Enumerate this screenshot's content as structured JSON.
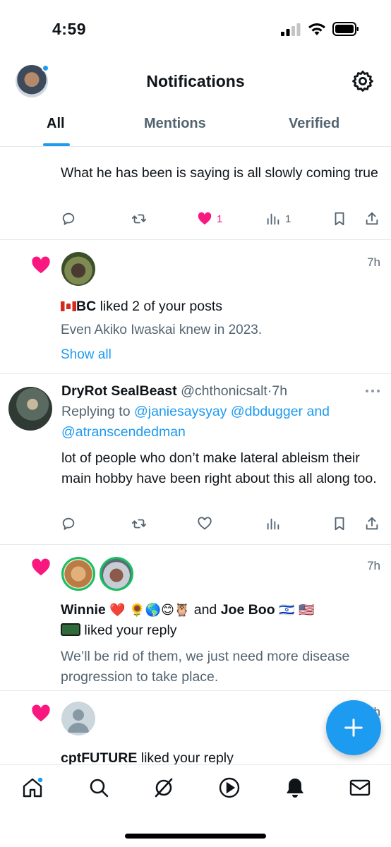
{
  "status": {
    "time": "4:59"
  },
  "header": {
    "title": "Notifications"
  },
  "tabs": [
    {
      "label": "All",
      "active": true
    },
    {
      "label": "Mentions",
      "active": false
    },
    {
      "label": "Verified",
      "active": false
    }
  ],
  "items": {
    "post1": {
      "text": "What he has been is saying is all slowly coming true",
      "likes": "1",
      "views": "1"
    },
    "like1": {
      "time": "7h",
      "actor": "BC",
      "action": " liked 2 of your posts",
      "preview": "Even Akiko Iwaskai knew in 2023.",
      "show_all": "Show all"
    },
    "reply1": {
      "name": "DryRot SealBeast",
      "handle": "@chthonicsalt",
      "dot": "·",
      "time": "7h",
      "replying_prefix": "Replying to ",
      "mention1": "@janiesaysyay",
      "mention2": "@dbdugger",
      "and": " and",
      "mention3": "@atranscendedman",
      "text": "lot of people who don’t make lateral ableism their main hobby have been right about this all along too."
    },
    "like2": {
      "time": "7h",
      "actor1": "Winnie",
      "emojis1": "❤️ 🌻🌎😊🦉",
      "and": " and ",
      "actor2": "Joe Boo",
      "emojis2": "🇮🇱 🇺🇸",
      "action": " liked your reply",
      "preview": "We’ll be rid of them, we just need more disease progression to take place."
    },
    "like3": {
      "time": "7h",
      "actor": "cptFUTURE",
      "action": " liked your reply"
    }
  },
  "colors": {
    "accent": "#1d9bf0",
    "like": "#f91880",
    "muted": "#536471"
  },
  "icons": [
    "signal-icon",
    "wifi-icon",
    "battery-icon",
    "gear-icon",
    "reply-icon",
    "repost-icon",
    "heart-icon",
    "views-icon",
    "bookmark-icon",
    "share-icon",
    "more-icon",
    "plus-icon",
    "home-icon",
    "search-icon",
    "grok-icon",
    "play-icon",
    "bell-icon",
    "mail-icon"
  ]
}
